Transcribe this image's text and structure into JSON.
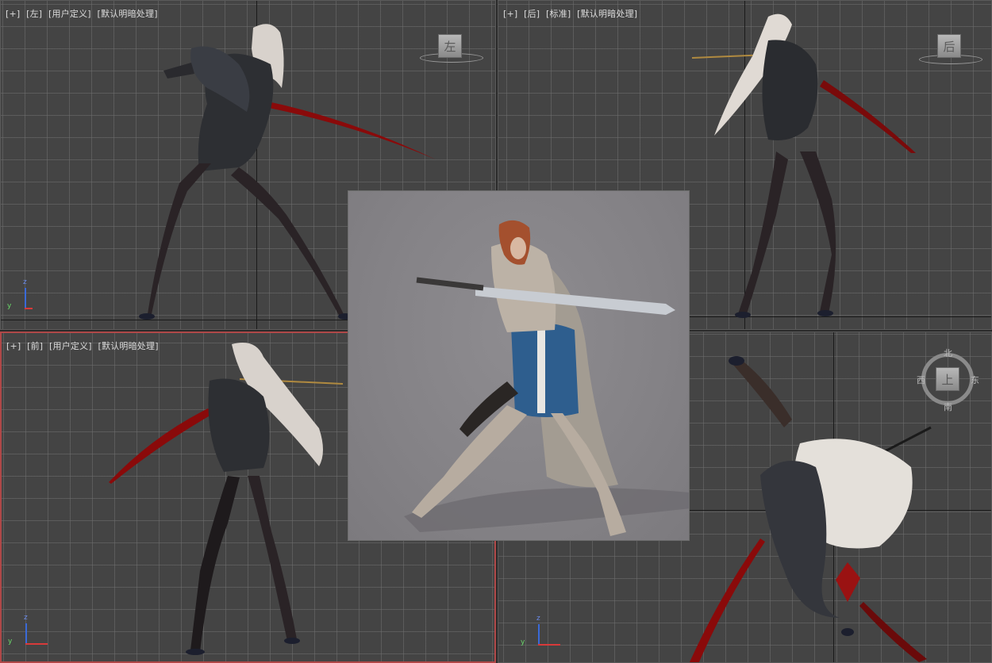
{
  "viewports": {
    "left": {
      "plus": "[+]",
      "view": "[左]",
      "shading": "[用户定义]",
      "lighting": "[默认明暗处理]",
      "cube_label": "左"
    },
    "back": {
      "plus": "[+]",
      "view": "[后]",
      "shading": "[标准]",
      "lighting": "[默认明暗处理]",
      "cube_label": "后"
    },
    "front": {
      "plus": "[+]",
      "view": "[前]",
      "shading": "[用户定义]",
      "lighting": "[默认明暗处理]"
    },
    "top": {
      "cube_label": "上",
      "compass": {
        "north": "北",
        "south": "南",
        "east": "东",
        "west": "西"
      }
    }
  },
  "gizmo": {
    "z_label": "z",
    "y_label": "y"
  },
  "colors": {
    "viewport_bg": "#444444",
    "grid": "#6e6e6e",
    "active_border": "#b04848",
    "sword_red": "#8a0a0a",
    "render_bg": "#858387"
  }
}
